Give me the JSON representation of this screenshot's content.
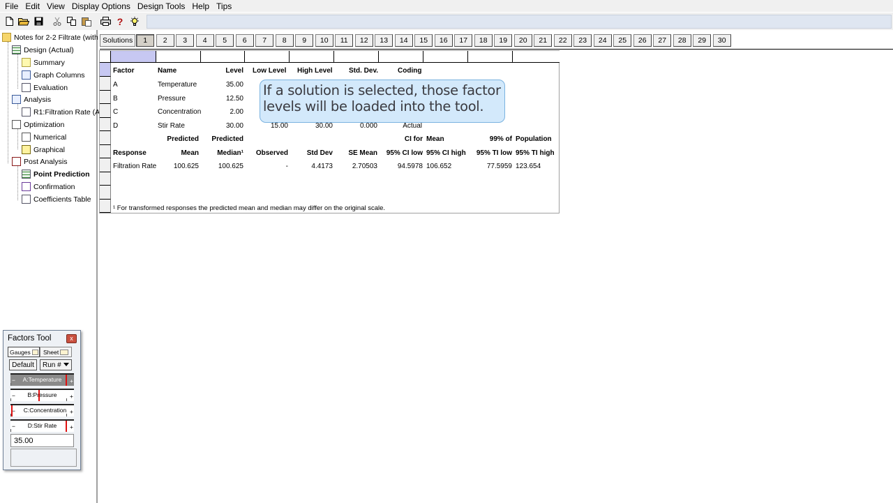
{
  "menu": [
    "File",
    "Edit",
    "View",
    "Display Options",
    "Design Tools",
    "Help",
    "Tips"
  ],
  "toolbar": {
    "new_icon": "new-document-icon",
    "open_icon": "open-folder-icon",
    "save_icon": "save-disk-icon",
    "cut_icon": "scissors-icon",
    "copy_icon": "copy-icon",
    "paste_icon": "paste-icon",
    "print_icon": "printer-icon",
    "help_icon": "question-mark-icon",
    "tips_icon": "lightbulb-icon",
    "help_glyph": "?"
  },
  "tree": {
    "root": "Notes for 2-2 Filtrate (with",
    "design": "Design (Actual)",
    "summary": "Summary",
    "graph_columns": "Graph Columns",
    "evaluation": "Evaluation",
    "analysis": "Analysis",
    "r1": "R1:Filtration Rate (A",
    "optimization": "Optimization",
    "numerical": "Numerical",
    "graphical": "Graphical",
    "post_analysis": "Post Analysis",
    "point_prediction": "Point Prediction",
    "confirmation": "Confirmation",
    "coefficients_table": "Coefficients Table"
  },
  "solutions": {
    "label": "Solutions",
    "tabs": [
      "1",
      "2",
      "3",
      "4",
      "5",
      "6",
      "7",
      "8",
      "9",
      "10",
      "11",
      "12",
      "13",
      "14",
      "15",
      "16",
      "17",
      "18",
      "19",
      "20",
      "21",
      "22",
      "23",
      "24",
      "25",
      "26",
      "27",
      "28",
      "29",
      "30"
    ],
    "active": "1"
  },
  "factors_table": {
    "headers": [
      "Factor",
      "Name",
      "Level",
      "Low Level",
      "High Level",
      "Std. Dev.",
      "Coding"
    ],
    "rows": [
      {
        "factor": "A",
        "name": "Temperature",
        "level": "35.00"
      },
      {
        "factor": "B",
        "name": "Pressure",
        "level": "12.50"
      },
      {
        "factor": "C",
        "name": "Concentration",
        "level": "2.00"
      },
      {
        "factor": "D",
        "name": "Stir Rate",
        "level": "30.00",
        "low": "15.00",
        "high": "30.00",
        "std": "0.000",
        "coding": "Actual"
      }
    ]
  },
  "response_table": {
    "header1": {
      "pred_mean": "Predicted",
      "pred_median": "Predicted",
      "ci_for": "CI for",
      "ci_mean": "Mean",
      "pop_99": "99% of",
      "population": "Population"
    },
    "header2": {
      "response": "Response",
      "mean": "Mean",
      "median": "Median¹",
      "observed": "Observed",
      "std_dev": "Std Dev",
      "se_mean": "SE Mean",
      "ci_low": "95% CI low",
      "ci_high": "95% CI high",
      "ti_low": "95% TI low",
      "ti_high": "95% TI high"
    },
    "row": {
      "response": "Filtration Rate",
      "mean": "100.625",
      "median": "100.625",
      "observed": "-",
      "std_dev": "4.4173",
      "se_mean": "2.70503",
      "ci_low": "94.5978",
      "ci_high": "106.652",
      "ti_low": "77.5959",
      "ti_high": "123.654"
    },
    "footnote": "¹ For transformed responses the predicted mean and median may differ on the original scale."
  },
  "callout": {
    "line1": "If a solution is selected, those factor",
    "line2": "levels will be loaded into the tool."
  },
  "factors_tool": {
    "title": "Factors Tool",
    "close_glyph": "x",
    "tab_gauges": "Gauges",
    "tab_sheet": "Sheet",
    "default_button": "Default",
    "run_select": "Run #",
    "gauges": [
      {
        "name": "A:Temperature",
        "level": 1.0
      },
      {
        "name": "B:Pressure",
        "level": 0.5
      },
      {
        "name": "C:Concentration",
        "level": 0.0
      },
      {
        "name": "D:Stir Rate",
        "level": 1.0
      }
    ],
    "minus_glyph": "−",
    "plus_glyph": "+",
    "value": "35.00"
  }
}
